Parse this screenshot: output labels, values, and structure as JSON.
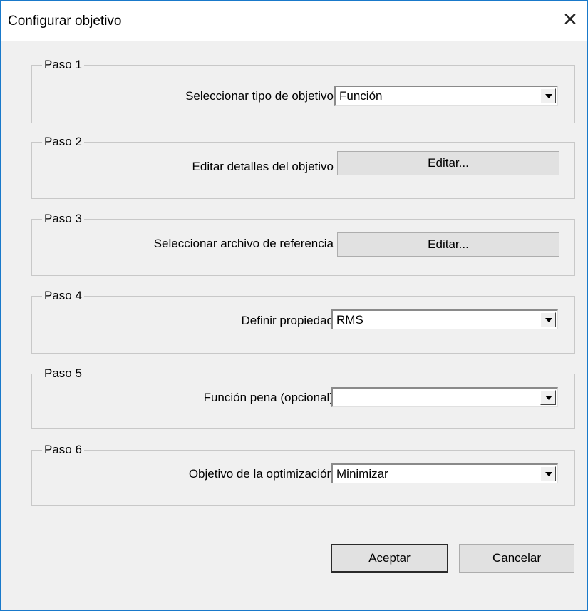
{
  "window": {
    "title": "Configurar objetivo",
    "close_glyph": "✕"
  },
  "steps": [
    {
      "title": "Paso 1",
      "label": "Seleccionar tipo de objetivo",
      "control": "combo",
      "value": "Función"
    },
    {
      "title": "Paso 2",
      "label": "Editar detalles del objetivo",
      "control": "button",
      "value": "Editar..."
    },
    {
      "title": "Paso 3",
      "label": "Seleccionar archivo de referencia",
      "control": "button",
      "value": "Editar..."
    },
    {
      "title": "Paso 4",
      "label": "Definir propiedad",
      "control": "combo",
      "value": "RMS"
    },
    {
      "title": "Paso 5",
      "label": "Función pena (opcional)",
      "control": "combo",
      "value": ""
    },
    {
      "title": "Paso 6",
      "label": "Objetivo de la optimización",
      "control": "combo",
      "value": "Minimizar"
    }
  ],
  "buttons": {
    "ok": "Aceptar",
    "cancel": "Cancelar"
  },
  "icons": {
    "dropdown": "chevron-down-icon",
    "close": "close-icon"
  }
}
